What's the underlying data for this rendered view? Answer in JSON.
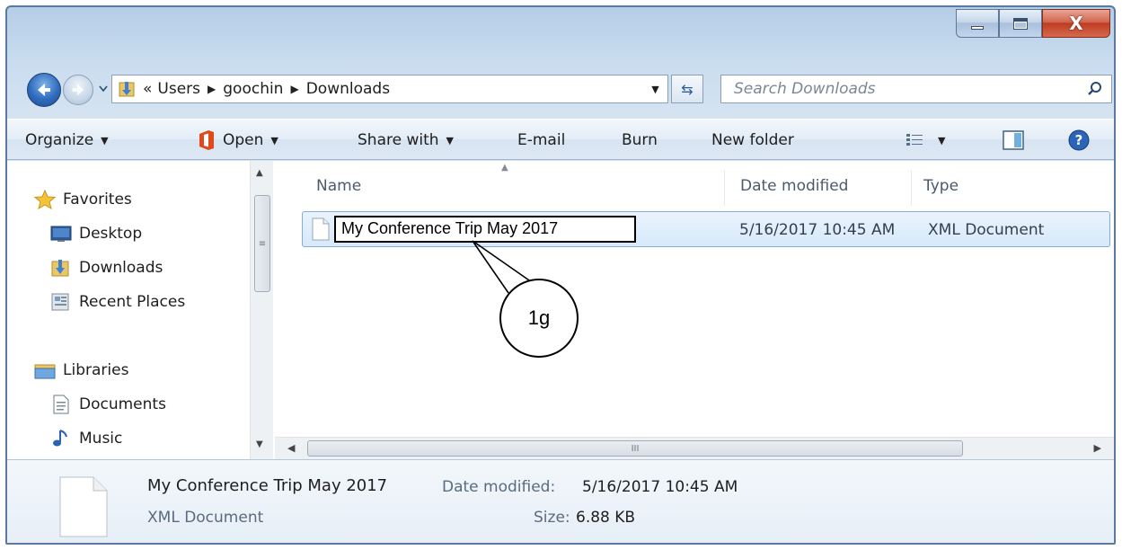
{
  "window": {
    "controls": {
      "minimize": "minimize",
      "maximize": "maximize",
      "close": "X"
    }
  },
  "address": {
    "overflow": "«",
    "crumbs": [
      "Users",
      "goochin",
      "Downloads"
    ]
  },
  "search": {
    "placeholder": "Search Downloads"
  },
  "toolbar": {
    "organize": "Organize",
    "open": "Open",
    "share_with": "Share with",
    "email": "E-mail",
    "burn": "Burn",
    "new_folder": "New folder"
  },
  "nav_pane": {
    "favorites": {
      "label": "Favorites",
      "items": [
        "Desktop",
        "Downloads",
        "Recent Places"
      ]
    },
    "libraries": {
      "label": "Libraries",
      "items": [
        "Documents",
        "Music"
      ]
    }
  },
  "file_list": {
    "columns": [
      "Name",
      "Date modified",
      "Type"
    ],
    "rows": [
      {
        "name": "My Conference Trip May 2017",
        "date_modified": "5/16/2017 10:45 AM",
        "type": "XML Document"
      }
    ],
    "scroll_glyph": "III"
  },
  "annotation": {
    "label": "1g"
  },
  "details": {
    "name": "My Conference Trip May 2017",
    "type": "XML Document",
    "date_label": "Date modified:",
    "date_value": "5/16/2017 10:45 AM",
    "size_label": "Size:",
    "size_value": "6.88 KB"
  },
  "colors": {
    "accent": "#2f6bbd",
    "selection": "#d7e9fb",
    "selection_border": "#84acdd",
    "close_button": "#c9482c"
  }
}
